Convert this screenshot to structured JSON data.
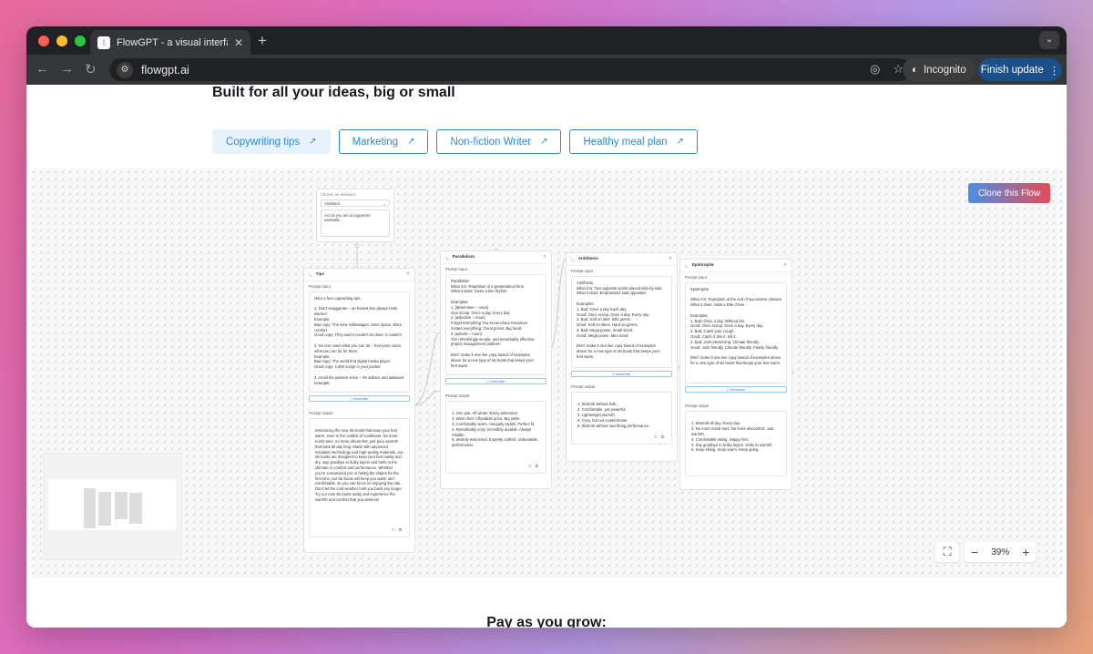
{
  "browser": {
    "tab_title": "FlowGPT - a visual interface f",
    "url": "flowgpt.ai",
    "incognito_label": "Incognito",
    "finish_update_label": "Finish update"
  },
  "page": {
    "heading": "Built for all your ideas, big or small",
    "chips": [
      {
        "label": "Copywriting tips",
        "active": true
      },
      {
        "label": "Marketing",
        "active": false
      },
      {
        "label": "Non-fiction Writer",
        "active": false
      },
      {
        "label": "Healthy meal plan",
        "active": false
      }
    ],
    "clone_label": "Clone this Flow",
    "zoom": "39%",
    "footer_heading": "Pay as you grow:"
  },
  "assistant": {
    "label": "Choose an assistant",
    "selected": "Assistant",
    "prompt": "Act as you are a copywriter assistant."
  },
  "nodes": {
    "tips": {
      "title": "Tips",
      "prompt_input_label": "Prompt input",
      "prompt_input": "Here a few copywriting tips:\n\n1. Don't exaggerate – an honest line always feels warmer.\nExample:\nBad copy: The New Volkswagen. More space. More comfort.\nGood copy: They said it couldn't be done. It couldn't\n\n2. No one cares what you can do – Everyone cares what you can do for them.\nExample:\nBad copy: The world first digital media player\nGood copy: 1,000 songs in your pocket\n\n3. Avoid the passive voice – it's indirect and awkward\nExample:",
      "generate_label": "Generate",
      "prompt_output_label": "Prompt output",
      "prompt_output": "Introducing the new ski boots that keep your feet warm, even in the coldest of conditions. No more numb toes, no more discomfort, just pure warmth that lasts all day long. Made with advanced insulation technology and high-quality materials, our ski boots are designed to keep your feet toasty and dry. Say goodbye to bulky layers and hello to the ultimate in comfort and performance. Whether you're a seasoned pro or hitting the slopes for the first time, our ski boots will keep you warm and comfortable, so you can focus on enjoying the ride. Don't let the cold weather hold you back any longer. Try our new ski boots today and experience the warmth and comfort that you deserve!"
    },
    "parallelism": {
      "title": "Parallelism",
      "prompt_input_label": "Prompt input",
      "prompt_input": "Parallelism\nWhat it is: Repetition of a grammatical form\nWhat it does: Gives a line rhythm\n\nExamples:\n1. [determiner – noun]\nOne scoop. Once a day. Every day.\n2. [adjective – noun]\nForget Everything You Know About Insurance\nInstant everything. Great prices. Big heart.\n3. [adverb – noun]\nThe refreshingly simple, and remarkably effective, project management platform.\n\nBrief: make 5 one line copy based of examples above for a new type of ski boots that keeps your feet warm.",
      "generate_label": "Generate",
      "prompt_output_label": "Prompt output",
      "prompt_output": "1. One pair. All winter. Every adventure.\n2. Warm feet. Affordable price. Big smile.\n3. Comfortably warm. Uniquely stylish. Perfect fit.\n4. Remarkably cozy. Incredibly durable. Always reliable.\n5. Warmly welcomed. Expertly crafted. Unbeatable performance."
    },
    "antithesis": {
      "title": "Antithesis",
      "prompt_input_label": "Prompt input",
      "prompt_input": "Antithesis\nWhat it is: Two opposite words placed side-by-side\nWhat it does: Emphasizes said opposites\n\nExamples:\n1. Bad: Once a day Each day\nGood: Once scoop. Once a day. Every day.\n2. Bad: Soft on skin. Kills germs\nGood: Soft on skins. Hard on germs.\n3. Bad: Mega power. Small sized.\nGood: Mega power. Mini sized.\n\nBrief: make 5 one line copy based of examples above for a new type of ski boots that keeps your feet warm.",
      "generate_label": "Generate",
      "prompt_output_label": "Prompt output",
      "prompt_output": "1. Warmth without bulk.\n2. Comfortable, yet powerful.\n3. Lightweight warmth.\n4. Cozy, but not cumbersome.\n5. Warmth without sacrificing performance."
    },
    "epistrophe": {
      "title": "Epistrophe",
      "prompt_input_label": "Prompt input",
      "prompt_input": "Epistrophe\n\nWhat it is: Repetition at the end of successive clauses\nWhat it does: Adds a little chime\n\nExamples:\n1. Bad: Once a day. Without fail.\nGood: Once scoop. Once a day. Every day.\n2. Bad: Catch your cough.\nGood: Catch it. Bin it. Kill it.\n3. Bad: Joint preserving. Climate friendly.\nGood: Joint friendly. Climate friendly. Family friendly.\n\nBrief: make 5 one line copy based of examples above for a new type of ski boots that keeps your feet warm.",
      "generate_label": "Generate",
      "prompt_output_label": "Prompt output",
      "prompt_output": "1. Warmth all day. Every day.\n2. No more numb toes. No more discomfort. Just warmth.\n3. Comfortable skiing. Happy feet.\n4. Say goodbye to bulky layers. Hello to warmth.\n5. Keep skiing. Keep warm. Keep going."
    }
  }
}
